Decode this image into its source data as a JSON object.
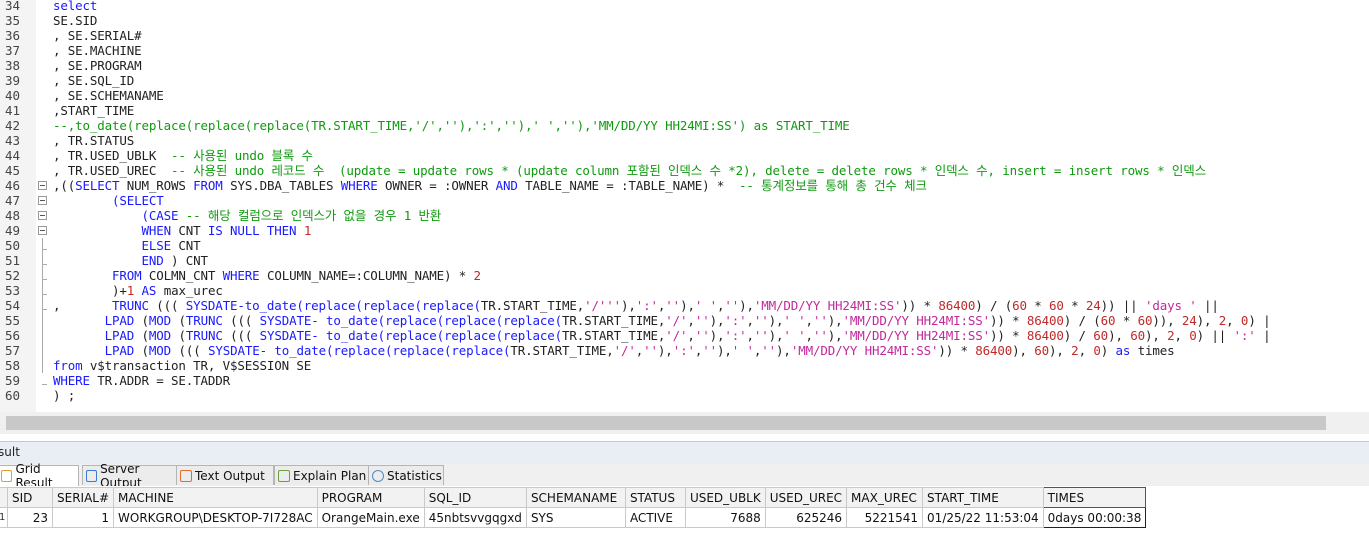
{
  "editor": {
    "lines": [
      {
        "num": "34",
        "segs": [
          [
            "k",
            "select"
          ]
        ]
      },
      {
        "num": "35",
        "segs": [
          [
            "",
            "SE.SID"
          ]
        ]
      },
      {
        "num": "36",
        "segs": [
          [
            "",
            ", SE.SERIAL#"
          ]
        ]
      },
      {
        "num": "37",
        "segs": [
          [
            "",
            ", SE.MACHINE"
          ]
        ]
      },
      {
        "num": "38",
        "segs": [
          [
            "",
            ", SE.PROGRAM"
          ]
        ]
      },
      {
        "num": "39",
        "segs": [
          [
            "",
            ", SE.SQL_ID"
          ]
        ]
      },
      {
        "num": "40",
        "segs": [
          [
            "",
            ", SE.SCHEMANAME"
          ]
        ]
      },
      {
        "num": "41",
        "segs": [
          [
            "",
            ",START_TIME"
          ]
        ]
      },
      {
        "num": "42",
        "segs": [
          [
            "c",
            "--,to_date(replace(replace(replace(TR.START_TIME,'/',''),':',''),' ',''),'MM/DD/YY HH24MI:SS') as START_TIME"
          ]
        ]
      },
      {
        "num": "43",
        "segs": [
          [
            "",
            ", TR.STATUS"
          ]
        ]
      },
      {
        "num": "44",
        "segs": [
          [
            "",
            ", TR.USED_UBLK  "
          ],
          [
            "c",
            "-- 사용된 undo 블록 수"
          ]
        ]
      },
      {
        "num": "45",
        "segs": [
          [
            "",
            ", TR.USED_UREC  "
          ],
          [
            "c",
            "-- 사용된 undo 레코드 수  (update = update rows * (update column 포함된 인덱스 수 *2), delete = delete rows * 인덱스 수, insert = insert rows * 인덱스"
          ]
        ]
      },
      {
        "num": "46",
        "segs": [
          [
            "",
            ",(("
          ],
          [
            "k",
            "SELECT"
          ],
          [
            "",
            " NUM_ROWS "
          ],
          [
            "k",
            "FROM"
          ],
          [
            "",
            " SYS.DBA_TABLES "
          ],
          [
            "k",
            "WHERE"
          ],
          [
            "",
            " OWNER = :OWNER "
          ],
          [
            "k",
            "AND"
          ],
          [
            "",
            " TABLE_NAME = :TABLE_NAME) *  "
          ],
          [
            "c",
            "-- 통계정보를 통해 총 건수 체크"
          ]
        ]
      },
      {
        "num": "47",
        "segs": [
          [
            "",
            "        "
          ],
          [
            "k",
            "(SELECT"
          ]
        ]
      },
      {
        "num": "48",
        "segs": [
          [
            "",
            "            "
          ],
          [
            "k",
            "(CASE"
          ],
          [
            "c",
            " -- 해당 컬럼으로 인덱스가 없을 경우 1 반환"
          ]
        ]
      },
      {
        "num": "49",
        "segs": [
          [
            "",
            "            "
          ],
          [
            "k",
            "WHEN"
          ],
          [
            "",
            " CNT "
          ],
          [
            "k",
            "IS NULL THEN"
          ],
          [
            "n",
            " 1"
          ]
        ]
      },
      {
        "num": "50",
        "segs": [
          [
            "",
            "            "
          ],
          [
            "k",
            "ELSE"
          ],
          [
            "",
            " CNT"
          ]
        ]
      },
      {
        "num": "51",
        "segs": [
          [
            "",
            "            "
          ],
          [
            "k",
            "END"
          ],
          [
            "",
            " ) CNT"
          ]
        ]
      },
      {
        "num": "52",
        "segs": [
          [
            "",
            "        "
          ],
          [
            "k",
            "FROM"
          ],
          [
            "",
            " COLMN_CNT "
          ],
          [
            "k",
            "WHERE"
          ],
          [
            "",
            " COLUMN_NAME=:COLUMN_NAME) * "
          ],
          [
            "n",
            "2"
          ]
        ]
      },
      {
        "num": "53",
        "segs": [
          [
            "",
            "        )+"
          ],
          [
            "n",
            "1"
          ],
          [
            "",
            " "
          ],
          [
            "k",
            "AS"
          ],
          [
            "",
            " max_urec"
          ]
        ]
      },
      {
        "num": "54",
        "segs": [
          [
            "",
            ",       "
          ],
          [
            "k",
            "TRUNC"
          ],
          [
            "",
            " ((( "
          ],
          [
            "k",
            "SYSDATE-to_date(replace(replace(replace("
          ],
          [
            "",
            "TR.START_TIME,"
          ],
          [
            "s",
            "'/'"
          ],
          [
            ",",
            ""
          ],
          [
            "s",
            "''"
          ],
          [
            "",
            "),"
          ],
          [
            "s",
            "':'"
          ],
          [
            "",
            ","
          ],
          [
            "s",
            "''"
          ],
          [
            "",
            "),"
          ],
          [
            "s",
            "' '"
          ],
          [
            "",
            ","
          ],
          [
            "s",
            "''"
          ],
          [
            "",
            "),"
          ],
          [
            "s",
            "'MM/DD/YY HH24MI:SS'"
          ],
          [
            "",
            "))"
          ],
          [
            "",
            " * "
          ],
          [
            "n",
            "86400"
          ],
          [
            "",
            ") / ("
          ],
          [
            "n",
            "60"
          ],
          [
            "",
            " * "
          ],
          [
            "n",
            "60"
          ],
          [
            "",
            " * "
          ],
          [
            "n",
            "24"
          ],
          [
            "",
            ")) || "
          ],
          [
            "s",
            "'days '"
          ],
          [
            "",
            " ||"
          ]
        ]
      },
      {
        "num": "55",
        "segs": [
          [
            "",
            "       "
          ],
          [
            "k",
            "LPAD"
          ],
          [
            "",
            " ("
          ],
          [
            "k",
            "MOD"
          ],
          [
            "",
            " ("
          ],
          [
            "k",
            "TRUNC"
          ],
          [
            "",
            " ((( "
          ],
          [
            "k",
            "SYSDATE- to_date(replace(replace(replace("
          ],
          [
            "",
            "TR.START_TIME,"
          ],
          [
            "s",
            "'/'"
          ],
          [
            "",
            ","
          ],
          [
            "s",
            "''"
          ],
          [
            "",
            "),"
          ],
          [
            "s",
            "':'"
          ],
          [
            "",
            ","
          ],
          [
            "s",
            "''"
          ],
          [
            "",
            "),"
          ],
          [
            "s",
            "' '"
          ],
          [
            "",
            ","
          ],
          [
            "s",
            "''"
          ],
          [
            "",
            "),"
          ],
          [
            "s",
            "'MM/DD/YY HH24MI:SS'"
          ],
          [
            "",
            "))"
          ],
          [
            "",
            " * "
          ],
          [
            "n",
            "86400"
          ],
          [
            "",
            ") / ("
          ],
          [
            "n",
            "60"
          ],
          [
            "",
            " * "
          ],
          [
            "n",
            "60"
          ],
          [
            "",
            ")), "
          ],
          [
            "n",
            "24"
          ],
          [
            "",
            "), "
          ],
          [
            "n",
            "2"
          ],
          [
            "",
            ", "
          ],
          [
            "n",
            "0"
          ],
          [
            "",
            ") |"
          ]
        ]
      },
      {
        "num": "56",
        "segs": [
          [
            "",
            "       "
          ],
          [
            "k",
            "LPAD"
          ],
          [
            "",
            " ("
          ],
          [
            "k",
            "MOD"
          ],
          [
            "",
            " ("
          ],
          [
            "k",
            "TRUNC"
          ],
          [
            "",
            " ((( "
          ],
          [
            "k",
            "SYSDATE- to_date(replace(replace(replace("
          ],
          [
            "",
            "TR.START_TIME,"
          ],
          [
            "s",
            "'/'"
          ],
          [
            "",
            ","
          ],
          [
            "s",
            "''"
          ],
          [
            "",
            "),"
          ],
          [
            "s",
            "':'"
          ],
          [
            "",
            ","
          ],
          [
            "s",
            "''"
          ],
          [
            "",
            "),"
          ],
          [
            "s",
            "' '"
          ],
          [
            "",
            ","
          ],
          [
            "s",
            "''"
          ],
          [
            "",
            "),"
          ],
          [
            "s",
            "'MM/DD/YY HH24MI:SS'"
          ],
          [
            "",
            "))"
          ],
          [
            "",
            " * "
          ],
          [
            "n",
            "86400"
          ],
          [
            "",
            ") / "
          ],
          [
            "n",
            "60"
          ],
          [
            "",
            "), "
          ],
          [
            "n",
            "60"
          ],
          [
            "",
            "), "
          ],
          [
            "n",
            "2"
          ],
          [
            "",
            ", "
          ],
          [
            "n",
            "0"
          ],
          [
            "",
            ") || "
          ],
          [
            "s",
            "':'"
          ],
          [
            "",
            " |"
          ]
        ]
      },
      {
        "num": "57",
        "segs": [
          [
            "",
            "       "
          ],
          [
            "k",
            "LPAD"
          ],
          [
            "",
            " ("
          ],
          [
            "k",
            "MOD"
          ],
          [
            "",
            " ((( "
          ],
          [
            "k",
            "SYSDATE- to_date(replace(replace(replace("
          ],
          [
            "",
            "TR.START_TIME,"
          ],
          [
            "s",
            "'/'"
          ],
          [
            "",
            ","
          ],
          [
            "s",
            "''"
          ],
          [
            "",
            "),"
          ],
          [
            "s",
            "':'"
          ],
          [
            "",
            ","
          ],
          [
            "s",
            "''"
          ],
          [
            "",
            "),"
          ],
          [
            "s",
            "' '"
          ],
          [
            "",
            ","
          ],
          [
            "s",
            "''"
          ],
          [
            "",
            "),"
          ],
          [
            "s",
            "'MM/DD/YY HH24MI:SS'"
          ],
          [
            "",
            "))"
          ],
          [
            "",
            " * "
          ],
          [
            "n",
            "86400"
          ],
          [
            "",
            "), "
          ],
          [
            "n",
            "60"
          ],
          [
            "",
            "), "
          ],
          [
            "n",
            "2"
          ],
          [
            "",
            ", "
          ],
          [
            "n",
            "0"
          ],
          [
            "",
            ") "
          ],
          [
            "k",
            "as"
          ],
          [
            "",
            " times"
          ]
        ]
      },
      {
        "num": "58",
        "segs": [
          [
            "k",
            "from"
          ],
          [
            "",
            " v$transaction TR, V$SESSION SE"
          ]
        ]
      },
      {
        "num": "59",
        "segs": [
          [
            "k",
            "WHERE"
          ],
          [
            "",
            " TR.ADDR = SE.TADDR"
          ]
        ]
      },
      {
        "num": "60",
        "segs": [
          [
            "",
            ") ;"
          ]
        ]
      }
    ]
  },
  "result_panel": {
    "title": "sult"
  },
  "tabs": [
    {
      "label": "Grid Result",
      "icon": "grid-icon",
      "active": true
    },
    {
      "label": "Server Output",
      "icon": "server-output-icon",
      "active": false
    },
    {
      "label": "Text Output",
      "icon": "text-output-icon",
      "active": false
    },
    {
      "label": "Explain Plan",
      "icon": "explain-plan-icon",
      "active": false
    },
    {
      "label": "Statistics",
      "icon": "statistics-icon",
      "active": false
    }
  ],
  "grid": {
    "columns": [
      "SID",
      "SERIAL#",
      "MACHINE",
      "PROGRAM",
      "SQL_ID",
      "SCHEMANAME",
      "STATUS",
      "USED_UBLK",
      "USED_UREC",
      "MAX_UREC",
      "START_TIME",
      "TIMES"
    ],
    "rows": [
      [
        "23",
        "1",
        "WORKGROUP\\DESKTOP-7I728AC",
        "OrangeMain.exe",
        "45nbtsvvgqgxd",
        "SYS",
        "ACTIVE",
        "7688",
        "625246",
        "5221541",
        "01/25/22 11:53:04",
        "0days 00:00:38"
      ]
    ],
    "row_marker": "1"
  }
}
